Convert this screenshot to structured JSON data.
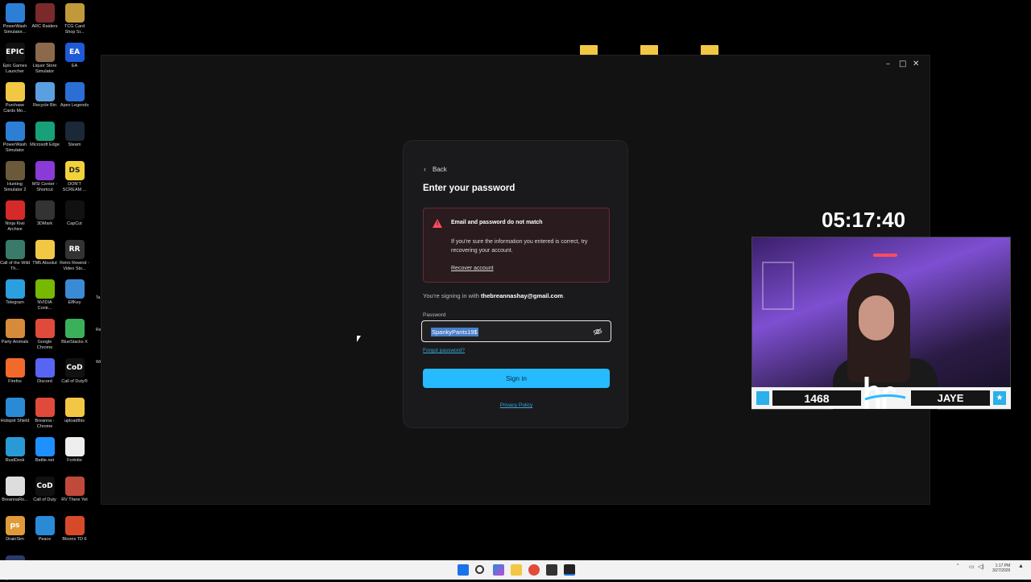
{
  "desktop": {
    "icons": [
      {
        "label": "PowerWash Simulator...",
        "glyph": "",
        "color": "#2d7fd6"
      },
      {
        "label": "ARC Raiders",
        "glyph": "",
        "color": "#7a2a2a"
      },
      {
        "label": "TCG Card Shop Si...",
        "glyph": "",
        "color": "#c09a3a"
      },
      {
        "label": "Epic Games Launcher",
        "glyph": "EPIC",
        "color": "#111"
      },
      {
        "label": "Liquor Store Simulator",
        "glyph": "",
        "color": "#8a6a4a"
      },
      {
        "label": "EA",
        "glyph": "EA",
        "color": "#1e5ad6"
      },
      {
        "label": "Purchase Cards Mo...",
        "glyph": "",
        "color": "#f2c744"
      },
      {
        "label": "Recycle Bin",
        "glyph": "",
        "color": "#5aa0e0"
      },
      {
        "label": "Apex Legends",
        "glyph": "",
        "color": "#2a6ed6"
      },
      {
        "label": "PowerWash Simulator",
        "glyph": "",
        "color": "#2d7fd6"
      },
      {
        "label": "Microsoft Edge",
        "glyph": "",
        "color": "#17a07a"
      },
      {
        "label": "Steam",
        "glyph": "",
        "color": "#1b2838"
      },
      {
        "label": "Hunting Simulator 2",
        "glyph": "",
        "color": "#6a5a3a"
      },
      {
        "label": "MSI Center - Shortcut",
        "glyph": "",
        "color": "#8a3ad6"
      },
      {
        "label": "DON'T SCREAM ...",
        "glyph": "DS",
        "color": "#f2d23a"
      },
      {
        "label": "Ninja Kiwi Archive",
        "glyph": "",
        "color": "#d62a2a"
      },
      {
        "label": "3DMark",
        "glyph": "",
        "color": "#333"
      },
      {
        "label": "CapCut",
        "glyph": "",
        "color": "#111"
      },
      {
        "label": "Call of the Wild Th...",
        "glyph": "",
        "color": "#3a7a6a"
      },
      {
        "label": "TM5 Absolut",
        "glyph": "",
        "color": "#f2c744"
      },
      {
        "label": "Retro Rewind - Video Sto...",
        "glyph": "RR",
        "color": "#333"
      },
      {
        "label": "Telegram",
        "glyph": "",
        "color": "#2aa0e0"
      },
      {
        "label": "NVIDIA Contr...",
        "glyph": "",
        "color": "#76b900"
      },
      {
        "label": "ElfKey",
        "glyph": "",
        "color": "#3a8ad6"
      },
      {
        "label": "Party Animals",
        "glyph": "",
        "color": "#d68a3a"
      },
      {
        "label": "Google Chrome",
        "glyph": "",
        "color": "#e04a3a"
      },
      {
        "label": "BlueStacks X",
        "glyph": "",
        "color": "#3ab05a"
      },
      {
        "label": "Firefox",
        "glyph": "",
        "color": "#f26a2a"
      },
      {
        "label": "Discord",
        "glyph": "",
        "color": "#5865f2"
      },
      {
        "label": "Call of Duty®",
        "glyph": "CoD",
        "color": "#111"
      },
      {
        "label": "Hotspot Shield",
        "glyph": "",
        "color": "#2a8ad6"
      },
      {
        "label": "Breanna - Chrome",
        "glyph": "",
        "color": "#e04a3a"
      },
      {
        "label": "uploadthis",
        "glyph": "",
        "color": "#f2c744"
      },
      {
        "label": "RustDesk",
        "glyph": "",
        "color": "#2a9ad6"
      },
      {
        "label": "Battle.net",
        "glyph": "",
        "color": "#1e90ff"
      },
      {
        "label": "Fortnite",
        "glyph": "",
        "color": "#eee"
      },
      {
        "label": "BreannaRo...",
        "glyph": "",
        "color": "#ddd"
      },
      {
        "label": "Call of Duty",
        "glyph": "CoD",
        "color": "#111"
      },
      {
        "label": "RV There Yet",
        "glyph": "",
        "color": "#c04a3a"
      },
      {
        "label": "DrainSim",
        "glyph": "ps",
        "color": "#e09a3a"
      },
      {
        "label": "Peace",
        "glyph": "",
        "color": "#2a8ad6"
      },
      {
        "label": "Bloons TD 6",
        "glyph": "",
        "color": "#d64a2a"
      },
      {
        "label": "Split Fiction",
        "glyph": "SF",
        "color": "#2a3a6a"
      }
    ],
    "partial_labels": [
      "Ta Sim",
      "Re Re",
      "WA"
    ]
  },
  "window": {
    "controls": {
      "minimize": "–",
      "maximize": "□",
      "close": "✕"
    }
  },
  "login": {
    "back_label": "Back",
    "title": "Enter your password",
    "alert": {
      "heading": "Email and password do not match",
      "message": "If you're sure the information you entered is correct, try recovering your account.",
      "link": "Recover account"
    },
    "signing_prefix": "You're signing in with",
    "email": "thebreannashay@gmail.com",
    "signing_suffix": ".",
    "password_label": "Password",
    "password_value": "SpankyPants19$",
    "forgot_label": "Forgot password?",
    "signin_label": "Sign in",
    "privacy_label": "Privacy Policy",
    "accent": "#26bbff",
    "error": "#ff4d5e"
  },
  "overlay": {
    "timer": "05:17:40",
    "stream_number": "1468",
    "stream_name": "JAYE"
  },
  "taskbar": {
    "clock_time": "1:17 PM",
    "clock_date": "3/27/2026"
  }
}
